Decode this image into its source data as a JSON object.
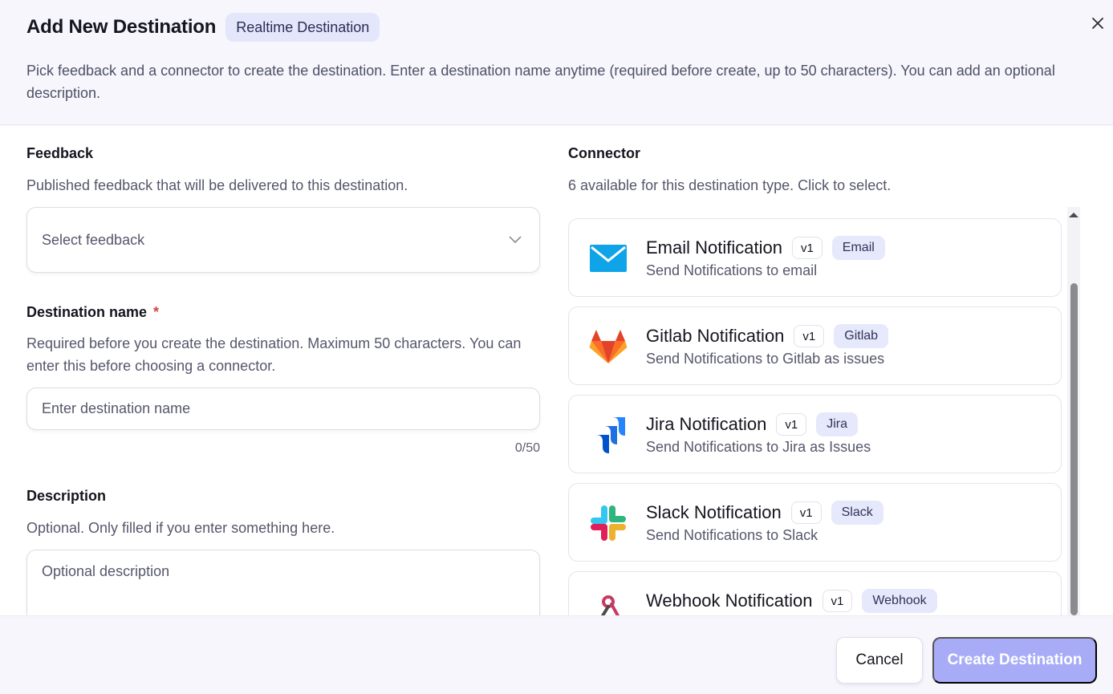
{
  "header": {
    "title": "Add New Destination",
    "type_badge": "Realtime Destination",
    "subtitle": "Pick feedback and a connector to create the destination. Enter a destination name anytime (required before create, up to 50 characters). You can add an optional description.",
    "close_icon": "close-icon"
  },
  "feedback": {
    "label": "Feedback",
    "help": "Published feedback that will be delivered to this destination.",
    "placeholder": "Select feedback"
  },
  "destination_name": {
    "label": "Destination name",
    "required_mark": "*",
    "help": "Required before you create the destination. Maximum 50 characters. You can enter this before choosing a connector.",
    "placeholder": "Enter destination name",
    "value": "",
    "counter": "0/50"
  },
  "description": {
    "label": "Description",
    "help": "Optional. Only filled if you enter something here.",
    "placeholder": "Optional description",
    "value": ""
  },
  "connector": {
    "label": "Connector",
    "help": "6 available for this destination type. Click to select.",
    "items": [
      {
        "name": "Email Notification",
        "version": "v1",
        "type": "Email",
        "desc": "Send Notifications to email",
        "icon": "email-icon"
      },
      {
        "name": "Gitlab Notification",
        "version": "v1",
        "type": "Gitlab",
        "desc": "Send Notifications to Gitlab as issues",
        "icon": "gitlab-icon"
      },
      {
        "name": "Jira Notification",
        "version": "v1",
        "type": "Jira",
        "desc": "Send Notifications to Jira as Issues",
        "icon": "jira-icon"
      },
      {
        "name": "Slack Notification",
        "version": "v1",
        "type": "Slack",
        "desc": "Send Notifications to Slack",
        "icon": "slack-icon"
      },
      {
        "name": "Webhook Notification",
        "version": "v1",
        "type": "Webhook",
        "desc": "",
        "icon": "webhook-icon"
      }
    ]
  },
  "footer": {
    "cancel_label": "Cancel",
    "create_label": "Create Destination"
  },
  "colors": {
    "accent_disabled": "#a8acf7",
    "badge_bg": "#e4e6fb",
    "required": "#d64545"
  }
}
